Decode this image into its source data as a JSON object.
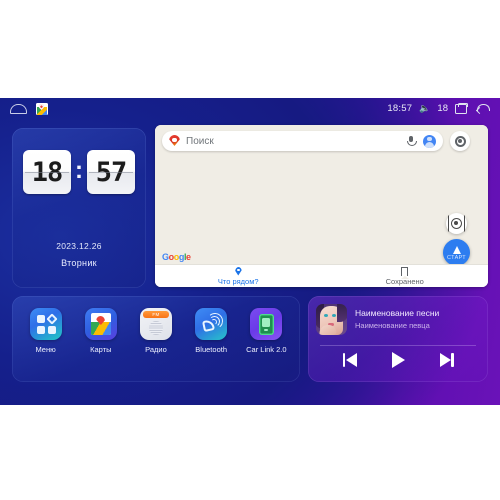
{
  "statusbar": {
    "home_icon": "home-icon",
    "maps_icon": "google-maps-icon",
    "clock": "18:57",
    "volume_icon": "speaker-volume-icon",
    "volume_level": "18",
    "recents_icon": "recents-icon",
    "back_icon": "back-arrow-icon"
  },
  "clock_widget": {
    "hours": "18",
    "minutes": "57",
    "separator": ":",
    "date": "2023.12.26",
    "weekday": "Вторник"
  },
  "map_widget": {
    "search": {
      "pin_icon": "google-maps-pin-icon",
      "placeholder": "Поиск",
      "value": "",
      "mic_icon": "microphone-icon",
      "avatar_icon": "account-avatar-icon"
    },
    "layers_button_icon": "map-settings-icon",
    "locate_button_icon": "my-location-icon",
    "start_button_label": "СТАРТ",
    "start_button_icon": "navigation-arrow-icon",
    "attribution": "Google",
    "tabs": [
      {
        "label": "Что рядом?",
        "icon": "location-pin-icon",
        "active": true
      },
      {
        "label": "Сохранено",
        "icon": "bookmark-icon",
        "active": false
      }
    ]
  },
  "apps": [
    {
      "label": "Меню",
      "icon": "menu-grid-icon"
    },
    {
      "label": "Карты",
      "icon": "maps-icon"
    },
    {
      "label": "Радио",
      "icon": "radio-fm-icon"
    },
    {
      "label": "Bluetooth",
      "icon": "bluetooth-phone-icon"
    },
    {
      "label": "Car Link 2.0",
      "icon": "car-link-icon"
    }
  ],
  "music_widget": {
    "album_art": "album-cover-portrait",
    "title": "Наименование песни",
    "artist": "Наименование певца",
    "controls": [
      {
        "name": "previous-track",
        "icon": "skip-previous-icon"
      },
      {
        "name": "play",
        "icon": "play-icon"
      },
      {
        "name": "next-track",
        "icon": "skip-next-icon"
      }
    ]
  },
  "colors": {
    "bg_left": "#121a86",
    "bg_right": "#6a12b8",
    "accent_blue": "#1a73e8",
    "map_bg": "#f0ede5"
  }
}
